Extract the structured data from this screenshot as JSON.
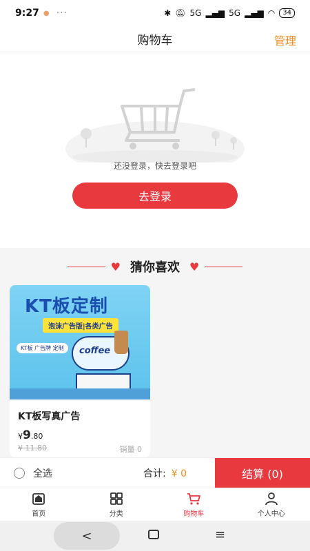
{
  "status_bar": {
    "time": "9:27",
    "dots": "···",
    "signal1": "5G",
    "signal2": "5G",
    "battery": "34"
  },
  "header": {
    "title": "购物车",
    "manage_label": "管理"
  },
  "empty_cart": {
    "message": "还没登录，快去登录吧",
    "login_button": "去登录"
  },
  "recommend": {
    "title": "猜你喜欢",
    "products": [
      {
        "image_title": "KT板定制",
        "image_tag": "泡沫广告版|各类广告",
        "image_sub": "KT板 广告牌 定制",
        "image_word": "coffee",
        "name": "KT板写真广告",
        "currency": "¥",
        "price_int": "9",
        "price_dec": ".80",
        "original_price": "¥ 11.80",
        "sales": "销量 0"
      }
    ]
  },
  "checkout": {
    "select_all": "全选",
    "total_label": "合计:",
    "total_amount": "¥ 0",
    "checkout_button": "结算 (0)"
  },
  "tabs": [
    {
      "label": "首页",
      "icon": "home-icon",
      "active": false
    },
    {
      "label": "分类",
      "icon": "category-icon",
      "active": false
    },
    {
      "label": "购物车",
      "icon": "cart-icon",
      "active": true
    },
    {
      "label": "个人中心",
      "icon": "person-icon",
      "active": false
    }
  ],
  "system_nav": {
    "back": "<",
    "menu": "≡"
  },
  "colors": {
    "accent_red": "#e8393f",
    "manage_orange": "#f08c1e"
  }
}
